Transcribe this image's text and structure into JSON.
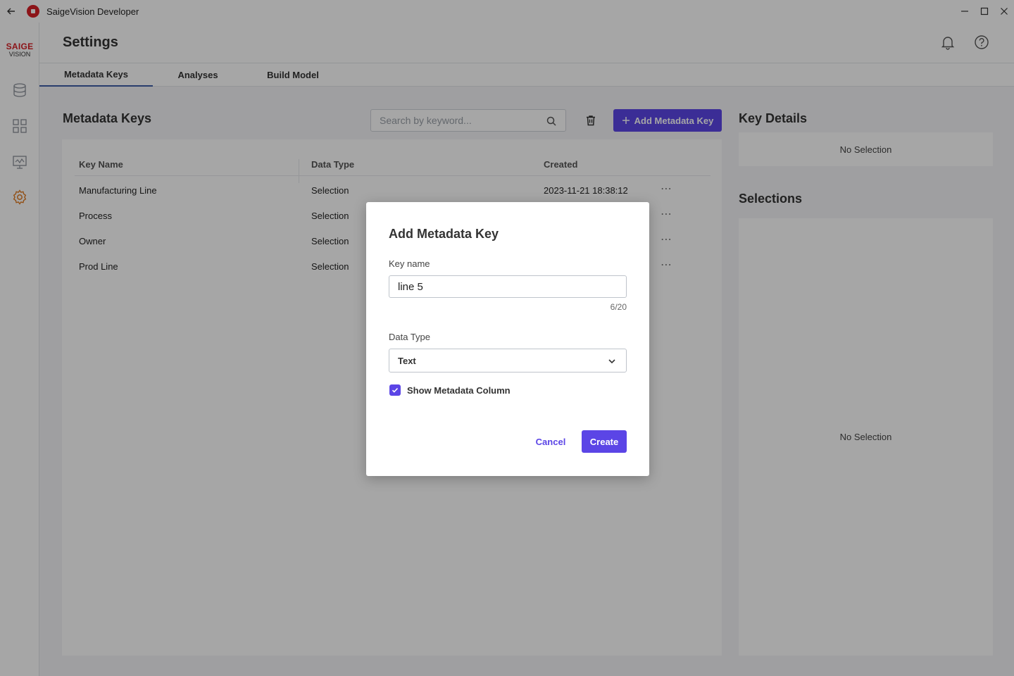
{
  "titlebar": {
    "app_title": "SaigeVision Developer"
  },
  "brand": {
    "line1": "SAIGE",
    "line2": "VISION"
  },
  "header": {
    "title": "Settings"
  },
  "tabs": [
    {
      "label": "Metadata Keys",
      "active": true
    },
    {
      "label": "Analyses",
      "active": false
    },
    {
      "label": "Build Model",
      "active": false
    }
  ],
  "metadata": {
    "title": "Metadata Keys",
    "search_placeholder": "Search by keyword...",
    "add_button": "Add Metadata Key",
    "columns": [
      "Key Name",
      "Data Type",
      "Created"
    ],
    "rows": [
      {
        "name": "Manufacturing Line",
        "type": "Selection",
        "created": "2023-11-21 18:38:12"
      },
      {
        "name": "Process",
        "type": "Selection",
        "created": ""
      },
      {
        "name": "Owner",
        "type": "Selection",
        "created": ""
      },
      {
        "name": "Prod Line",
        "type": "Selection",
        "created": ""
      }
    ]
  },
  "key_details": {
    "title": "Key Details",
    "empty": "No Selection"
  },
  "selections": {
    "title": "Selections",
    "empty": "No Selection"
  },
  "modal": {
    "title": "Add Metadata Key",
    "key_name_label": "Key name",
    "key_name_value": "line 5",
    "counter": "6/20",
    "data_type_label": "Data Type",
    "data_type_value": "Text",
    "checkbox_label": "Show Metadata Column",
    "checkbox_checked": true,
    "cancel": "Cancel",
    "create": "Create"
  },
  "colors": {
    "accent": "#5b45e6",
    "brand_red": "#d71f26",
    "tab_underline": "#3f5fa8"
  },
  "icons": [
    "back-arrow-icon",
    "app-logo-icon",
    "minimize-icon",
    "maximize-icon",
    "close-icon",
    "database-icon",
    "grid-icon",
    "monitor-icon",
    "gear-icon",
    "bell-icon",
    "help-icon",
    "search-icon",
    "trash-icon",
    "plus-icon",
    "more-icon",
    "chevron-down-icon",
    "check-icon"
  ]
}
